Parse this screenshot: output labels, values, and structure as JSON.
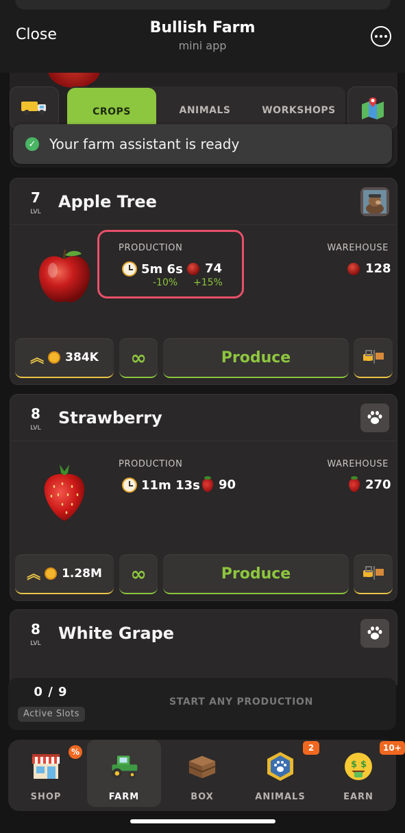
{
  "window": {
    "close_label": "Close",
    "title": "Bullish Farm",
    "subtitle": "mini app"
  },
  "tabs": {
    "left_icon": "truck-icon",
    "items": [
      {
        "label": "CROPS",
        "active": true
      },
      {
        "label": "ANIMALS",
        "active": false
      },
      {
        "label": "WORKSHOPS",
        "active": false
      }
    ],
    "right_icon": "map-icon"
  },
  "toast": {
    "message": "Your farm assistant is ready"
  },
  "labels": {
    "lvl": "LVL",
    "production": "PRODUCTION",
    "warehouse": "WAREHOUSE",
    "produce": "Produce"
  },
  "cards": [
    {
      "level": "7",
      "name": "Apple Tree",
      "corner_icon": "manager-avatar-icon",
      "production_time": "5m 6s",
      "production_qty": "74",
      "time_bonus": "-10%",
      "qty_bonus": "+15%",
      "warehouse": "128",
      "upgrade_price": "384K"
    },
    {
      "level": "8",
      "name": "Strawberry",
      "corner_icon": "paw-icon",
      "production_time": "11m 13s",
      "production_qty": "90",
      "warehouse": "270",
      "upgrade_price": "1.28M"
    },
    {
      "level": "8",
      "name": "White Grape",
      "corner_icon": "paw-icon"
    }
  ],
  "slots": {
    "count": "0 / 9",
    "label": "Active Slots",
    "start_text": "START ANY PRODUCTION"
  },
  "nav": [
    {
      "label": "SHOP",
      "icon": "shop-icon",
      "badge": "%"
    },
    {
      "label": "FARM",
      "icon": "tractor-icon",
      "active": true
    },
    {
      "label": "BOX",
      "icon": "crate-icon"
    },
    {
      "label": "ANIMALS",
      "icon": "paw-badge-icon",
      "badge": "2"
    },
    {
      "label": "EARN",
      "icon": "money-face-icon",
      "badge": "10+"
    }
  ],
  "colors": {
    "accent_green": "#8dc63f",
    "accent_gold": "#e8c547",
    "highlight": "#e8506a",
    "badge_orange": "#f06820"
  }
}
